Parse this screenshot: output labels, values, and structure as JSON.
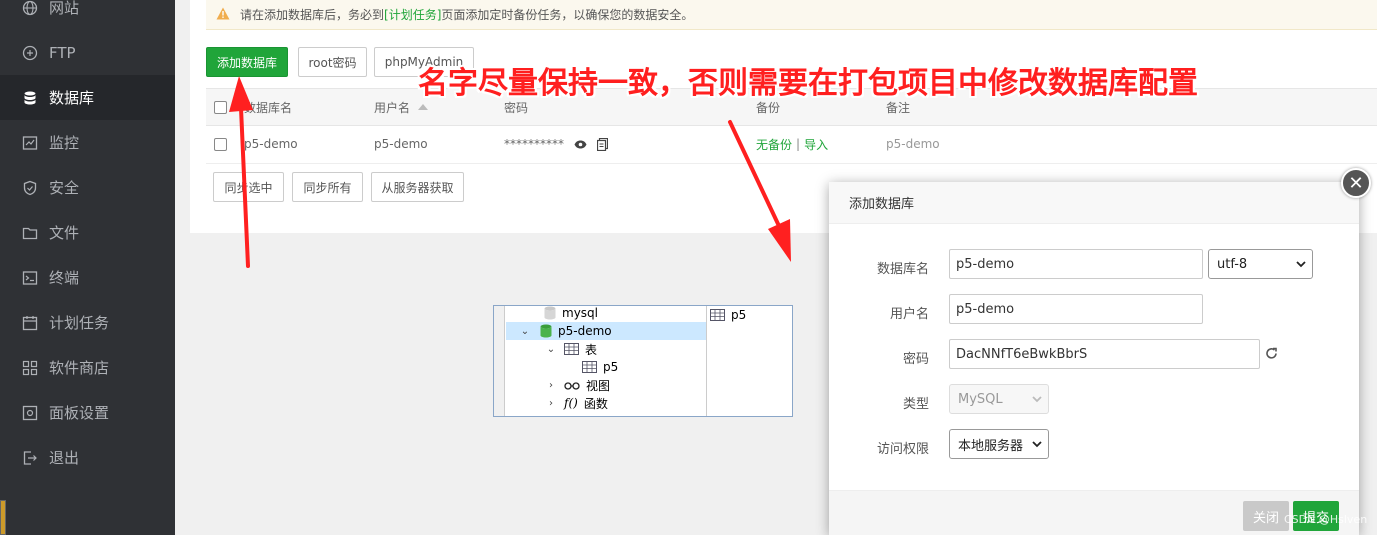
{
  "sidebar": {
    "items": [
      {
        "label": "网站",
        "icon": "globe-icon"
      },
      {
        "label": "FTP",
        "icon": "ftp-icon"
      },
      {
        "label": "数据库",
        "icon": "database-icon",
        "active": true
      },
      {
        "label": "监控",
        "icon": "monitor-icon"
      },
      {
        "label": "安全",
        "icon": "shield-icon"
      },
      {
        "label": "文件",
        "icon": "folder-icon"
      },
      {
        "label": "终端",
        "icon": "terminal-icon"
      },
      {
        "label": "计划任务",
        "icon": "calendar-icon"
      },
      {
        "label": "软件商店",
        "icon": "grid-icon"
      },
      {
        "label": "面板设置",
        "icon": "gear-icon"
      },
      {
        "label": "退出",
        "icon": "logout-icon"
      }
    ]
  },
  "notice": {
    "prefix": "请在添加数据库后，务必到",
    "link": "[计划任务]",
    "suffix": "页面添加定时备份任务，以确保您的数据安全。"
  },
  "toolbar": {
    "add_db": "添加数据库",
    "root_pwd": "root密码",
    "phpmyadmin": "phpMyAdmin"
  },
  "table": {
    "headers": {
      "name": "数据库名",
      "user": "用户名",
      "password": "密码",
      "backup": "备份",
      "note": "备注"
    },
    "rows": [
      {
        "name": "p5-demo",
        "user": "p5-demo",
        "password": "**********",
        "backup": "无备份",
        "backup_sep": "|",
        "import": "导入",
        "note": "p5-demo"
      }
    ]
  },
  "actions": {
    "sync_selected": "同步选中",
    "sync_all": "同步所有",
    "fetch_server": "从服务器获取"
  },
  "annotation": "名字尽量保持一致，否则需要在打包项目中修改数据库配置",
  "tree": {
    "items": [
      {
        "label": "mysql"
      },
      {
        "label": "p5-demo",
        "selected": true
      },
      {
        "label": "表"
      },
      {
        "label": "p5"
      },
      {
        "label": "视图"
      },
      {
        "label": "函数"
      }
    ],
    "detail": "p5"
  },
  "modal": {
    "title": "添加数据库",
    "fields": {
      "db_name_label": "数据库名",
      "db_name_value": "p5-demo",
      "charset": "utf-8",
      "user_label": "用户名",
      "user_value": "p5-demo",
      "password_label": "密码",
      "password_value": "DacNNfT6eBwkBbrS",
      "type_label": "类型",
      "type_value": "MySQL",
      "access_label": "访问权限",
      "access_value": "本地服务器"
    },
    "close_btn": "关闭",
    "submit_btn": "提交"
  },
  "watermark": "CSDN @Hslven",
  "colors": {
    "accent": "#20a53a",
    "annotation": "#ff1f1f",
    "sidebar_bg": "#2f3135"
  }
}
